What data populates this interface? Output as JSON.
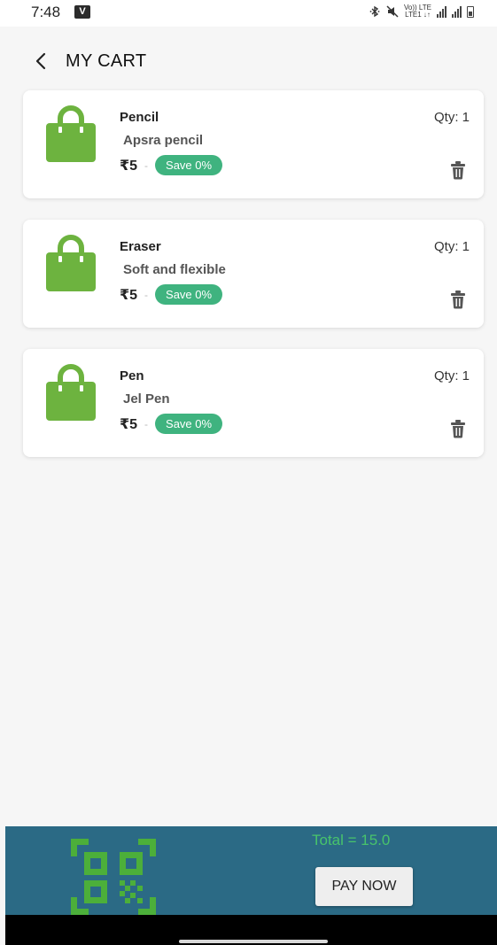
{
  "status_bar": {
    "time": "7:48",
    "app_badge": "V",
    "net_label_top": "Vo)) LTE",
    "net_label_bottom": "LTE1 ↓↑"
  },
  "header": {
    "title": "MY CART",
    "back_icon": "chevron-left-icon"
  },
  "cart": {
    "items": [
      {
        "name": "Pencil",
        "description": "Apsra pencil",
        "price": "₹5",
        "separator": "-",
        "save": "Save 0%",
        "qty": "Qty: 1"
      },
      {
        "name": "Eraser",
        "description": "Soft and flexible",
        "price": "₹5",
        "separator": "-",
        "save": "Save 0%",
        "qty": "Qty: 1"
      },
      {
        "name": "Pen",
        "description": "Jel Pen",
        "price": "₹5",
        "separator": "-",
        "save": "Save 0%",
        "qty": "Qty: 1"
      }
    ],
    "item_icon": "shopping-bag-icon",
    "delete_icon": "trash-icon"
  },
  "footer": {
    "total": "Total = 15.0",
    "pay_label": "PAY NOW",
    "qr_icon": "qr-code-icon"
  },
  "colors": {
    "bag_green": "#6db33f",
    "badge_green": "#3fb37f",
    "bottom_bar": "#2b6a85",
    "total_text": "#48c46b",
    "qr_green": "#4caf3a"
  }
}
